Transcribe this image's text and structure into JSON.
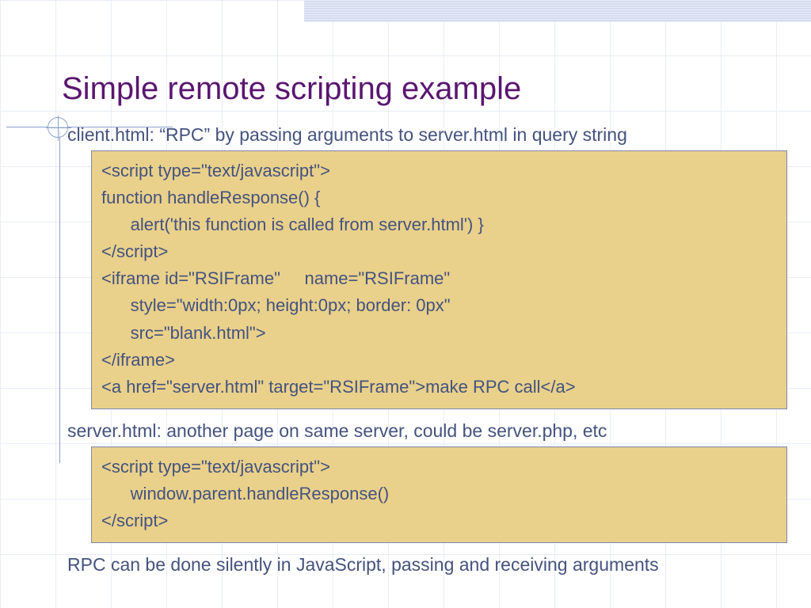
{
  "title": "Simple remote scripting example",
  "client_caption": "client.html: “RPC” by passing arguments to server.html in query string",
  "client_code": [
    "<script type=\"text/javascript\">",
    "function handleResponse() {",
    "      alert('this function is called from server.html') }",
    "</script>",
    "<iframe id=\"RSIFrame\"     name=\"RSIFrame\"",
    "      style=\"width:0px; height:0px; border: 0px\"",
    "      src=\"blank.html\">",
    "</iframe>",
    "<a href=\"server.html\" target=\"RSIFrame\">make RPC call</a>"
  ],
  "server_caption": "server.html: another page on same server, could be server.php, etc",
  "server_code": [
    "<script type=\"text/javascript\">",
    "      window.parent.handleResponse()",
    "</script>"
  ],
  "footnote": "RPC can be done silently in JavaScript, passing and receiving arguments"
}
